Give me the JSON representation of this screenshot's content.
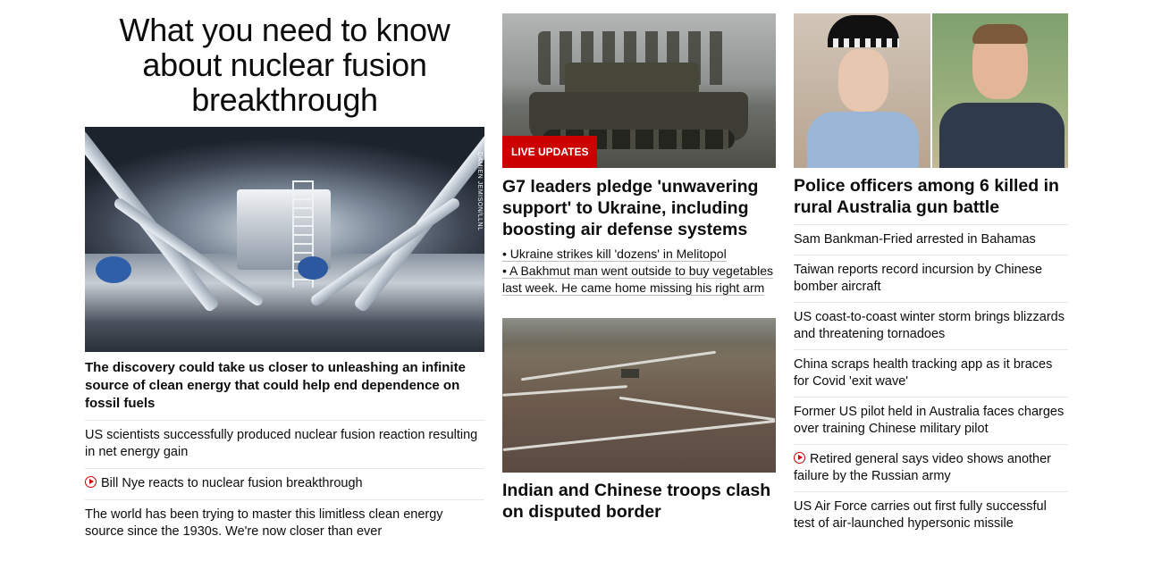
{
  "col1": {
    "headline": "What you need to know about nuclear fusion breakthrough",
    "photo_credit": "DAMIEN JEMISON/LLNL",
    "summary": "The discovery could take us closer to unleashing an infinite source of clean energy that could help end dependence on fossil fuels",
    "links": [
      {
        "text": "US scientists successfully produced nuclear fusion reaction resulting in net energy gain",
        "video": false
      },
      {
        "text": "Bill Nye reacts to nuclear fusion breakthrough",
        "video": true
      },
      {
        "text": "The world has been trying to master this limitless clean energy source since the 1930s. We're now closer than ever",
        "video": false
      }
    ]
  },
  "col2": {
    "badge": "LIVE UPDATES",
    "headline": "G7 leaders pledge 'unwavering support' to Ukraine, including boosting air defense systems",
    "bullets": [
      "• Ukraine strikes kill 'dozens' in Melitopol",
      "• A Bakhmut man went outside to buy vegetables last week. He came home missing his right arm"
    ],
    "story2_headline": "Indian and Chinese troops clash on disputed border"
  },
  "col3": {
    "headline": "Police officers among 6 killed in rural Australia gun battle",
    "links": [
      {
        "text": "Sam Bankman-Fried arrested in Bahamas",
        "video": false
      },
      {
        "text": "Taiwan reports record incursion by Chinese bomber aircraft",
        "video": false
      },
      {
        "text": "US coast-to-coast winter storm brings blizzards and threatening tornadoes",
        "video": false
      },
      {
        "text": "China scraps health tracking app as it braces for Covid 'exit wave'",
        "video": false
      },
      {
        "text": "Former US pilot held in Australia faces charges over training Chinese military pilot",
        "video": false
      },
      {
        "text": "Retired general says video shows another failure by the Russian army",
        "video": true
      },
      {
        "text": "US Air Force carries out first fully successful test of air-launched hypersonic missile",
        "video": false
      }
    ]
  },
  "colors": {
    "accent_red": "#cc0000",
    "text": "#0c0c0c",
    "divider": "#e6e6e6"
  },
  "icons": {
    "video": "play-circle-icon"
  }
}
